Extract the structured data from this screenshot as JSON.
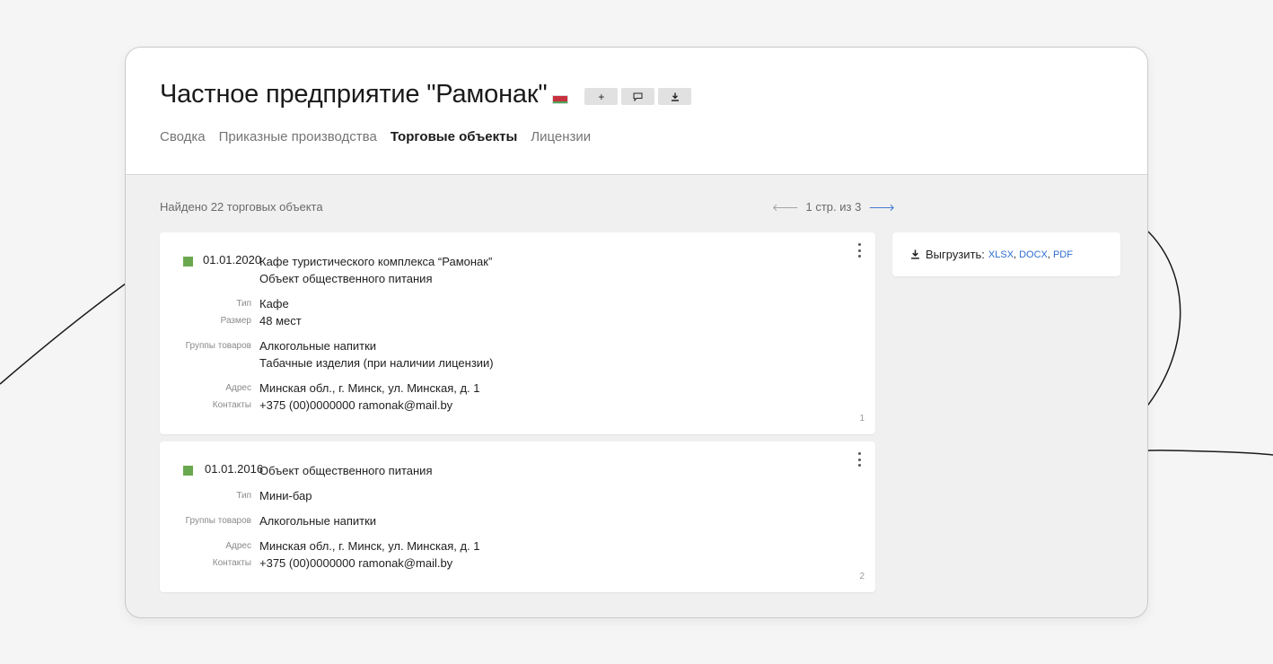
{
  "header": {
    "title": "Частное предприятие \"Рамонак\"",
    "flag": "belarus-flag-icon",
    "buttons": [
      {
        "icon": "plus-icon",
        "glyph": "+"
      },
      {
        "icon": "comment-icon",
        "glyph": "🗩"
      },
      {
        "icon": "download-icon",
        "glyph": "⤓"
      }
    ],
    "tabs": [
      "Сводка",
      "Приказные производства",
      "Торговые объекты",
      "Лицензии"
    ],
    "active_tab": "Торговые объекты"
  },
  "listing": {
    "found_text": "Найдено 22 торговых объекта",
    "pager": {
      "prev": "🡐",
      "text": "1 стр. из 3",
      "next": "🡒"
    }
  },
  "cards": [
    {
      "date": "01.01.2020",
      "name": "Кафе туристического комплекса “Рамонак”",
      "kind": "Объект общественного питания",
      "type_label": "Тип",
      "type": "Кафе",
      "size_label": "Размер",
      "size": "48 мест",
      "groups_label": "Группы товаров",
      "groups": [
        "Алкогольные напитки",
        "Табачные изделия (при наличии лицензии)"
      ],
      "address_label": "Адрес",
      "address": "Минская обл., г. Минск, ул. Минская, д. 1",
      "contacts_label": "Контакты",
      "contacts": "+375 (00)0000000 ramonak@mail.by",
      "number": "1"
    },
    {
      "date": "01.01.2016",
      "kind": "Объект общественного питания",
      "type_label": "Тип",
      "type": "Мини-бар",
      "groups_label": "Группы товаров",
      "groups": [
        "Алкогольные напитки"
      ],
      "address_label": "Адрес",
      "address": "Минская обл., г. Минск, ул. Минская, д. 1",
      "contacts_label": "Контакты",
      "contacts": "+375 (00)0000000 ramonak@mail.by",
      "number": "2"
    }
  ],
  "export": {
    "icon": "download-icon",
    "glyph": "⤓",
    "label": "Выгрузить:",
    "formats": [
      "XLSX",
      "DOCX",
      "PDF"
    ],
    "separator": ","
  },
  "colors": {
    "status": "#6aa84f",
    "link": "#2f6dd0"
  }
}
